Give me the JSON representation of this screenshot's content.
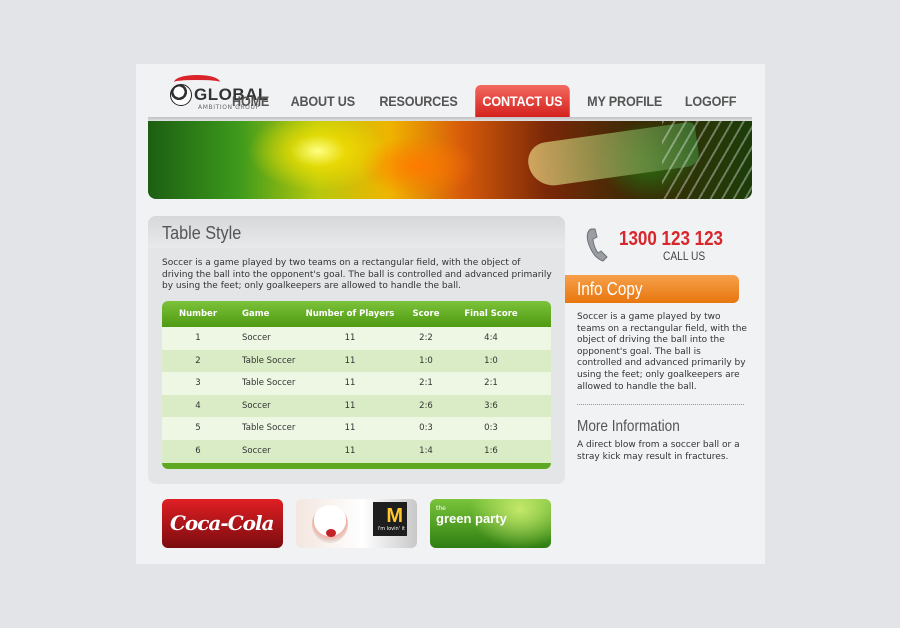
{
  "brand": {
    "name": "GLOBAL",
    "tagline": "AMBITION GROUP"
  },
  "nav": {
    "items": [
      {
        "label": "HOME"
      },
      {
        "label": "ABOUT US"
      },
      {
        "label": "RESOURCES"
      },
      {
        "label": "CONTACT US",
        "active": true
      },
      {
        "label": "MY PROFILE"
      },
      {
        "label": "LOGOFF"
      }
    ]
  },
  "main": {
    "title": "Table Style",
    "description": "Soccer is a game played by two teams on a rectangular field, with the object of driving the ball into the opponent's goal. The ball is controlled and advanced primarily by using the feet; only goalkeepers are allowed to handle the ball.",
    "table": {
      "headers": [
        "Number",
        "Game",
        "Number of Players",
        "Score",
        "Final Score"
      ],
      "rows": [
        [
          "1",
          "Soccer",
          "11",
          "2:2",
          "4:4"
        ],
        [
          "2",
          "Table Soccer",
          "11",
          "1:0",
          "1:0"
        ],
        [
          "3",
          "Table Soccer",
          "11",
          "2:1",
          "2:1"
        ],
        [
          "4",
          "Soccer",
          "11",
          "2:6",
          "3:6"
        ],
        [
          "5",
          "Table Soccer",
          "11",
          "0:3",
          "0:3"
        ],
        [
          "6",
          "Soccer",
          "11",
          "1:4",
          "1:6"
        ]
      ]
    }
  },
  "ads": {
    "coke": "Coca-Cola",
    "mcd_slogan": "i'm lovin' it",
    "green_small": "the",
    "green_big": "green party"
  },
  "contact": {
    "phone": "1300 123 123",
    "call_label": "CALL US"
  },
  "info": {
    "title": "Info Copy",
    "text": "Soccer is a game played by two teams on a rectangular field, with the object of driving the ball into the opponent's goal. The ball is controlled and advanced primarily by using the feet; only goalkeepers are allowed to handle the ball."
  },
  "more": {
    "title": "More Information",
    "text": "A direct blow from a soccer ball or a stray kick may result in fractures."
  },
  "colors": {
    "accent_red": "#d8262b",
    "accent_orange": "#e8760e",
    "table_green": "#5fa822",
    "background": "#e3e4e8"
  },
  "icons": {
    "phone": "phone-icon",
    "logo_ball": "soccer-ball-icon"
  }
}
